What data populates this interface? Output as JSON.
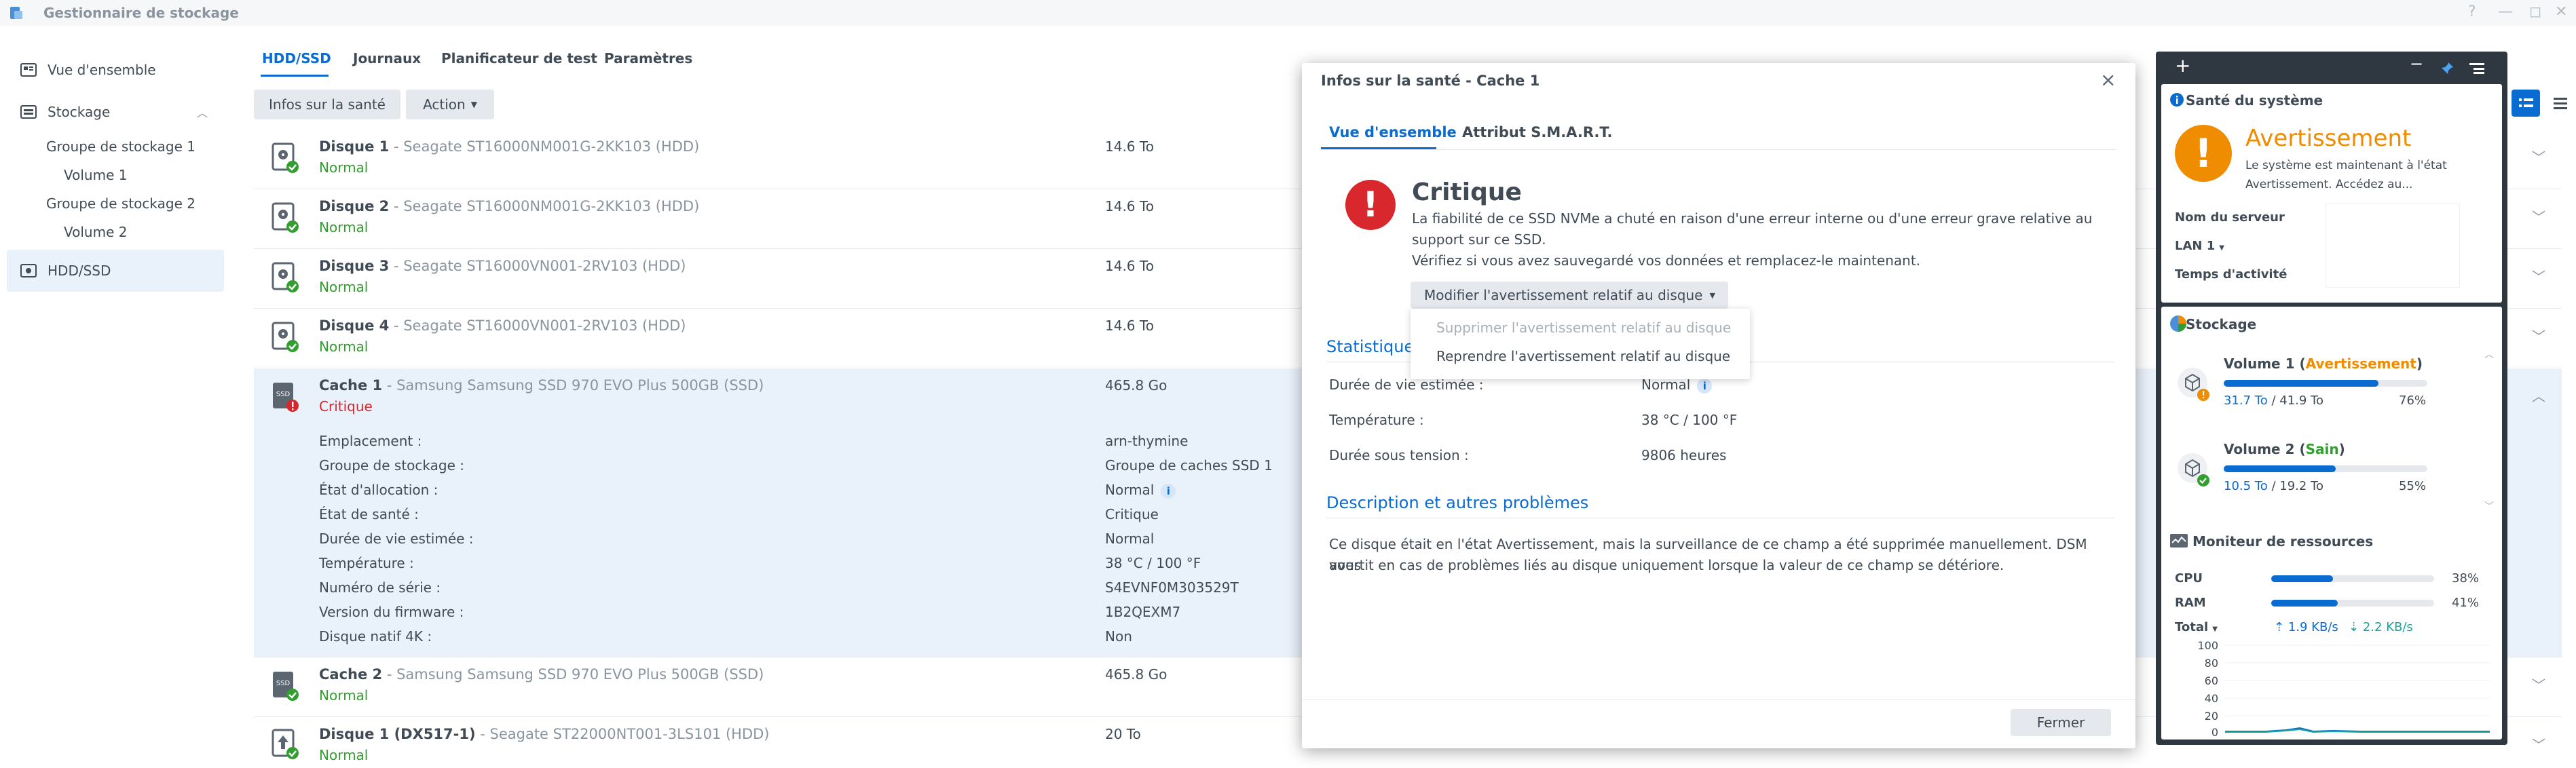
{
  "window": {
    "title": "Gestionnaire de stockage",
    "controls": [
      "?",
      "—",
      "◻",
      "✕"
    ]
  },
  "sidebar": {
    "items": [
      {
        "label": "Vue d'ensemble",
        "icon": "overview-icon"
      },
      {
        "label": "Stockage",
        "icon": "storage-icon"
      },
      {
        "label": "HDD/SSD",
        "icon": "disk-icon"
      }
    ],
    "subitems": [
      {
        "label": "Groupe de stockage 1"
      },
      {
        "label": "Volume 1"
      },
      {
        "label": "Groupe de stockage 2"
      },
      {
        "label": "Volume 2"
      }
    ]
  },
  "tabs": [
    "HDD/SSD",
    "Journaux",
    "Planificateur de test",
    "Paramètres"
  ],
  "toolbar": {
    "health_button": "Infos sur la santé",
    "action_button": "Action"
  },
  "disks": [
    {
      "name": "Disque 1",
      "model": " - Seagate ST16000NM001G-2KK103 (HDD)",
      "status": "Normal",
      "size": "14.6 To"
    },
    {
      "name": "Disque 2",
      "model": " - Seagate ST16000NM001G-2KK103 (HDD)",
      "status": "Normal",
      "size": "14.6 To"
    },
    {
      "name": "Disque 3",
      "model": " - Seagate ST16000VN001-2RV103 (HDD)",
      "status": "Normal",
      "size": "14.6 To"
    },
    {
      "name": "Disque 4",
      "model": " - Seagate ST16000VN001-2RV103 (HDD)",
      "status": "Normal",
      "size": "14.6 To"
    },
    {
      "name": "Cache 1",
      "model": " - Samsung Samsung SSD 970 EVO Plus 500GB (SSD)",
      "status": "Critique",
      "size": "465.8 Go"
    },
    {
      "name": "Cache 2",
      "model": " - Samsung Samsung SSD 970 EVO Plus 500GB (SSD)",
      "status": "Normal",
      "size": "465.8 Go"
    },
    {
      "name": "Disque 1 (DX517-1)",
      "model": " - Seagate ST22000NT001-3LS101 (HDD)",
      "status": "Normal",
      "size": "20 To"
    }
  ],
  "cache1_details": [
    {
      "label": "Emplacement :",
      "value": "arn-thymine"
    },
    {
      "label": "Groupe de stockage :",
      "value": "Groupe de caches SSD 1"
    },
    {
      "label": "État d'allocation :",
      "value": "Normal"
    },
    {
      "label": "État de santé :",
      "value": "Critique"
    },
    {
      "label": "Durée de vie estimée :",
      "value": "Normal"
    },
    {
      "label": "Température :",
      "value": "38 °C / 100 °F"
    },
    {
      "label": "Numéro de série :",
      "value": "S4EVNF0M303529T"
    },
    {
      "label": "Version du firmware :",
      "value": "1B2QEXM7"
    },
    {
      "label": "Disque natif 4K :",
      "value": "Non"
    }
  ],
  "dialog": {
    "title": "Infos sur la santé - Cache 1",
    "tabs": [
      "Vue d'ensemble",
      "Attribut S.M.A.R.T."
    ],
    "critical_title": "Critique",
    "critical_text_1": "La fiabilité de ce SSD NVMe a chuté en raison d'une erreur interne ou d'une erreur grave relative au",
    "critical_text_2": "support sur ce SSD.",
    "critical_text_3": "Vérifiez si vous avez sauvegardé vos données et remplacez-le maintenant.",
    "warning_dropdown": "Modifier l'avertissement relatif au disque",
    "dropdown_items": [
      "Supprimer l'avertissement relatif au disque",
      "Reprendre l'avertissement relatif au disque"
    ],
    "stats_title": "Statistiques",
    "stats": [
      {
        "label": "Durée de vie estimée :",
        "value": "Normal"
      },
      {
        "label": "Température :",
        "value": "38 °C / 100 °F"
      },
      {
        "label": "Durée sous tension :",
        "value": "9806 heures"
      }
    ],
    "desc_title": "Description et autres problèmes",
    "desc_text_1": "Ce disque était en l'état Avertissement, mais la surveillance de ce champ a été supprimée manuellement. DSM vous",
    "desc_text_2": "avertit en cas de problèmes liés au disque uniquement lorsque la valeur de ce champ se détériore.",
    "close_button": "Fermer"
  },
  "widgets": {
    "health": {
      "title": "Santé du système",
      "status": "Avertissement",
      "text_1": "Le système est maintenant à l'état",
      "text_2": "Avertissement. Accédez au...",
      "rows": [
        "Nom du serveur",
        "LAN 1",
        "Temps d'activité"
      ]
    },
    "storage": {
      "title": "Stockage",
      "volumes": [
        {
          "name": "Volume 1",
          "state": "Avertissement",
          "used": "31.7 To",
          "total": " / 41.9 To",
          "percent": "76%",
          "fill": 0.76,
          "state_color": "#f08c00"
        },
        {
          "name": "Volume 2",
          "state": "Sain",
          "used": "10.5 To",
          "total": " / 19.2 To",
          "percent": "55%",
          "fill": 0.55,
          "state_color": "#329e2f"
        }
      ]
    },
    "resources": {
      "title": "Moniteur de ressources",
      "cpu_label": "CPU",
      "cpu_value": "38%",
      "cpu_fill": 0.38,
      "ram_label": "RAM",
      "ram_value": "41%",
      "ram_fill": 0.41,
      "total_label": "Total",
      "upload": "1.9 KB/s",
      "download": "2.2 KB/s",
      "y_ticks": [
        "100",
        "80",
        "60",
        "40",
        "20",
        "0"
      ]
    }
  },
  "colors": {
    "accent": "#0a6bd1",
    "normal": "#329e2f",
    "critical": "#d8272d",
    "warning": "#f08c00"
  }
}
